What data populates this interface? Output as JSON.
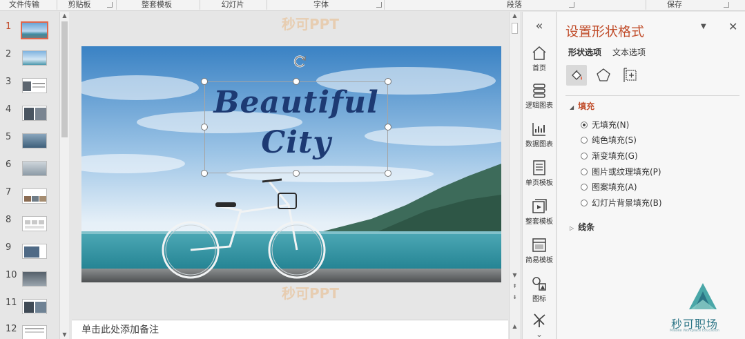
{
  "ribbon": {
    "groups": [
      "文件传输",
      "剪贴板",
      "整套模板",
      "幻灯片",
      "字体",
      "段落",
      "保存"
    ]
  },
  "thumbnails": {
    "numbers": [
      "1",
      "2",
      "3",
      "4",
      "5",
      "6",
      "7",
      "8",
      "9",
      "10",
      "11",
      "12"
    ],
    "active_index": 0
  },
  "slide": {
    "title_line1": "Beautiful",
    "title_line2": "City",
    "watermark": "秒可PPT"
  },
  "notes": {
    "placeholder": "单击此处添加备注"
  },
  "iconbar": {
    "collapse_glyph": "«",
    "items": [
      "首页",
      "逻辑图表",
      "数据图表",
      "单页模板",
      "整套模板",
      "简易模板",
      "图标"
    ]
  },
  "pane": {
    "title": "设置形状格式",
    "option_tabs": [
      "形状选项",
      "文本选项"
    ],
    "section_fill": "填充",
    "fill_options": [
      "无填充(N)",
      "纯色填充(S)",
      "渐变填充(G)",
      "图片或纹理填充(P)",
      "图案填充(A)",
      "幻灯片背景填充(B)"
    ],
    "selected_fill": 0,
    "section_line": "线条"
  },
  "logo": {
    "name": "秒可职场",
    "tagline": "Miaoke Workplace Education"
  },
  "colors": {
    "accent": "#c14e2c",
    "thumb_active": "#e0664b",
    "title_text": "#1d3a73",
    "logo": "#2c7586"
  }
}
